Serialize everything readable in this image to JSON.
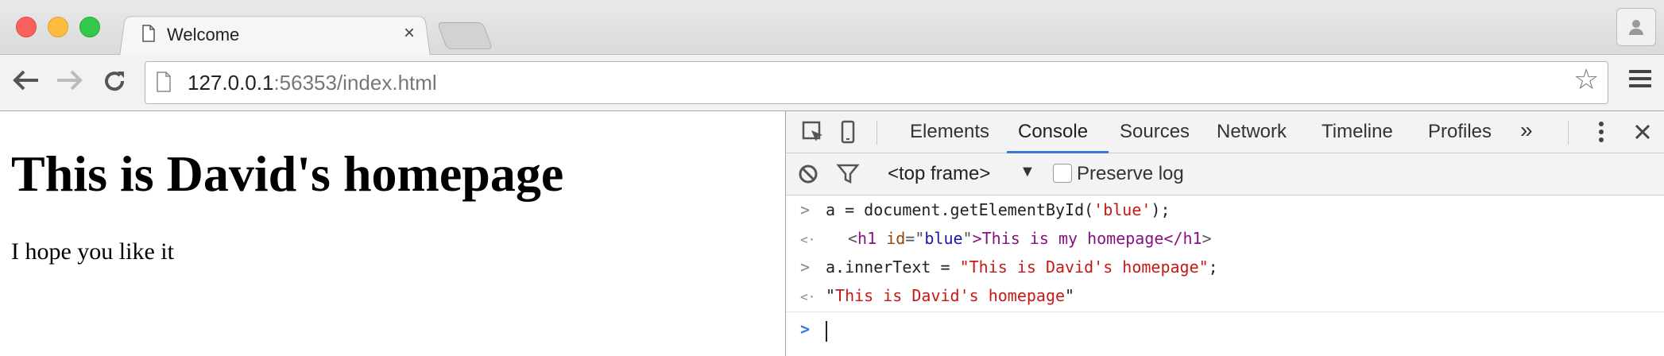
{
  "browser": {
    "tab_title": "Welcome",
    "tab_close": "×",
    "url_host": "127.0.0.1",
    "url_rest": ":56353/index.html"
  },
  "page": {
    "heading": "This is David's homepage",
    "paragraph": "I hope you like it"
  },
  "devtools": {
    "tabs": [
      "Elements",
      "Console",
      "Sources",
      "Network",
      "Timeline",
      "Profiles"
    ],
    "active_tab": "Console",
    "more": "»",
    "frame_selector": "<top frame>",
    "frame_caret": "▼",
    "preserve_log_label": "Preserve log",
    "preserve_log_checked": false,
    "console_lines": [
      {
        "prompt": ">",
        "parts": [
          "a = document.getElementById(",
          "'blue'",
          ");"
        ]
      },
      {
        "prompt": "<·",
        "parts": [
          "<",
          "h1",
          " ",
          "id",
          "=\"",
          "blue",
          "\"",
          ">This is my homepage</",
          "h1",
          ">"
        ]
      },
      {
        "prompt": ">",
        "parts": [
          "a.innerText = ",
          "\"This is David's homepage\"",
          ";"
        ]
      },
      {
        "prompt": "<·",
        "parts": [
          "\"",
          "This is David's homepage",
          "\""
        ]
      }
    ],
    "input_prompt": ">"
  },
  "colors": {
    "accent": "#3879d9",
    "string": "#c41a16",
    "tag": "#881280"
  }
}
